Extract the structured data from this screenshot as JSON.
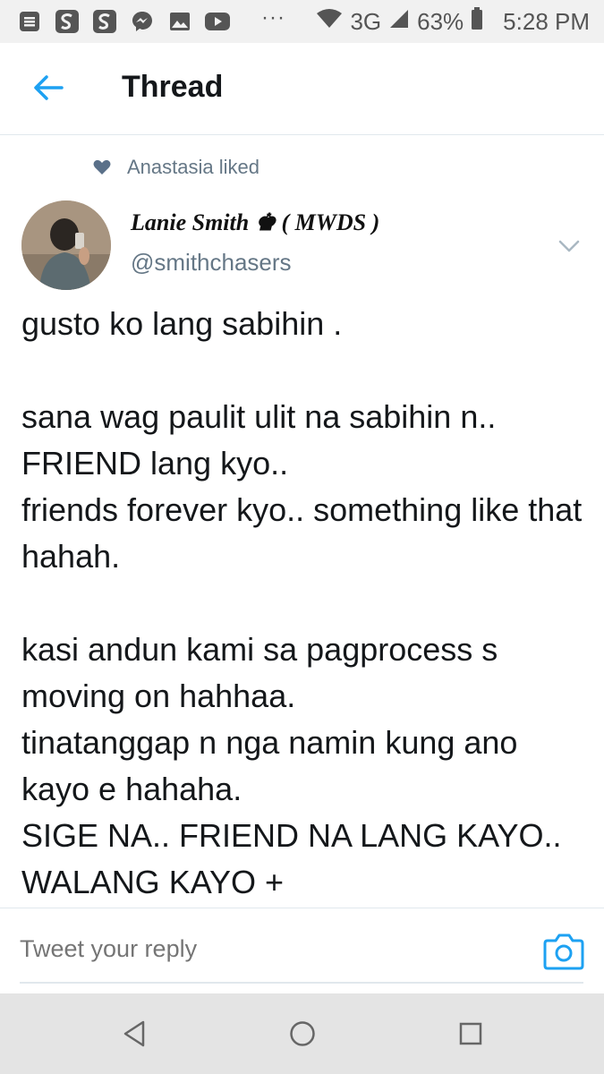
{
  "status_bar": {
    "icons": [
      "notes-icon",
      "s-app-icon",
      "s-app-icon",
      "messenger-icon",
      "gallery-icon",
      "youtube-icon"
    ],
    "more": "···",
    "network": "3G",
    "battery": "63%",
    "time": "5:28 PM"
  },
  "header": {
    "title": "Thread"
  },
  "social_context": {
    "text": "Anastasia liked"
  },
  "tweet": {
    "author_name": "Lanie Smith ♚ ( MWDS )",
    "handle": "@smithchasers",
    "paragraphs": [
      "gusto ko lang sabihin .",
      "sana wag paulit ulit na sabihin n..\nFRIEND lang kyo..\nfriends forever kyo.. something like that hahah.",
      "kasi andun kami sa pagprocess s moving on hahhaa.\ntinatanggap n nga namin kung ano kayo e hahaha.\nSIGE NA.. FRIEND NA LANG KAYO.. WALANG KAYO +"
    ]
  },
  "reply": {
    "placeholder": "Tweet your reply"
  },
  "colors": {
    "accent": "#1da1f2",
    "secondary_text": "#657786",
    "heart": "#5a7089"
  }
}
